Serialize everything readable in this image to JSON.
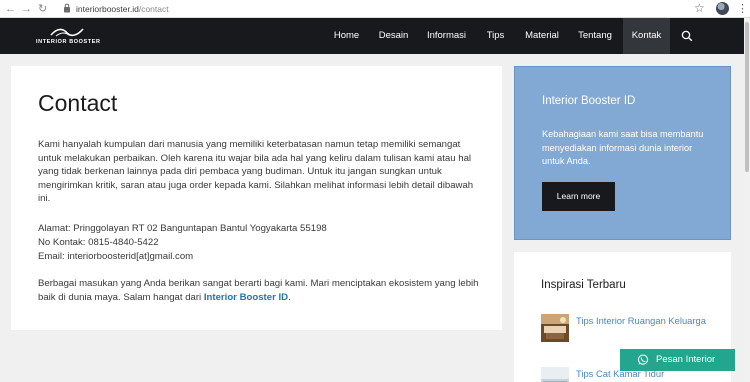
{
  "browser": {
    "url_host": "interiorbooster.id",
    "url_path": "/contact"
  },
  "header": {
    "logo_text": "INTERIOR BOOSTER",
    "menu": [
      {
        "label": "Home"
      },
      {
        "label": "Desain"
      },
      {
        "label": "Informasi"
      },
      {
        "label": "Tips"
      },
      {
        "label": "Material"
      },
      {
        "label": "Tentang"
      },
      {
        "label": "Kontak",
        "active": true
      }
    ]
  },
  "main": {
    "title": "Contact",
    "intro": "Kami hanyalah kumpulan dari manusia yang memiliki keterbatasan namun tetap memiliki semangat untuk melakukan perbaikan. Oleh karena itu wajar bila ada hal yang keliru dalam tulisan kami atau hal yang tidak berkenan lainnya pada diri pembaca yang budiman. Untuk itu jangan sungkan untuk mengirimkan kritik, saran atau juga order kepada kami. Silahkan melihat informasi lebih detail dibawah ini.",
    "address": "Alamat: Pringgolayan RT 02 Banguntapan Bantul Yogyakarta 55198",
    "phone": "No Kontak: 0815-4840-5422",
    "email": "Email: interiorboosterid[at]gmail.com",
    "closing_text": "Berbagai masukan yang Anda berikan sangat berarti bagi kami. Mari menciptakan ekosistem yang lebih baik di dunia maya. Salam hangat dari ",
    "closing_link": "Interior Booster ID",
    "closing_end": "."
  },
  "sidebar": {
    "promo_title": "Interior Booster ID",
    "promo_text": "Kebahagiaan kami saat bisa membantu menyediakan informasi dunia interior untuk Anda.",
    "promo_button": "Learn more",
    "recent_title": "Inspirasi Terbaru",
    "posts": [
      {
        "title": "Tips Interior Ruangan Keluarga"
      },
      {
        "title": "Tips Cat Kamar Tidur"
      }
    ]
  },
  "whatsapp": {
    "label": "Pesan Interior"
  },
  "colors": {
    "header_bg": "#17191c",
    "promo_bg": "#82a9d4",
    "link": "#1e73be",
    "whatsapp_bg": "#23a68e"
  }
}
